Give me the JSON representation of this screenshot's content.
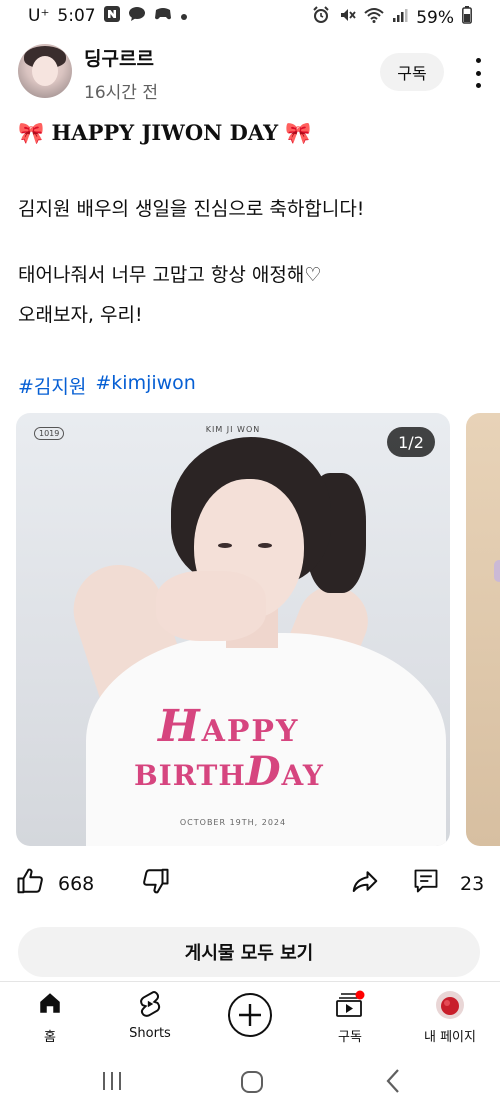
{
  "status_bar": {
    "carrier": "U⁺",
    "time": "5:07",
    "battery": "59%"
  },
  "post": {
    "channel_name": "딩구르르",
    "time_ago": "16시간 전",
    "subscribe_label": "구독",
    "title_emoji_left": "🎀",
    "title_text": "HAPPY JIWON DAY",
    "title_emoji_right": "🎀",
    "body_line_1": "김지원 배우의 생일을 진심으로 축하합니다!",
    "body_line_2": "태어나줘서 너무 고맙고 항상 애정해♡",
    "body_line_3": "오래보자, 우리!",
    "hashtags": [
      "#김지원",
      "#kimjiwon"
    ]
  },
  "image": {
    "counter": "1/2",
    "logo_badge": "1019",
    "top_caption": "KIM JI WON",
    "birthday_line_1_initial": "H",
    "birthday_line_1_rest": "APPY",
    "birthday_line_2_start": "BIRTH",
    "birthday_line_2_initial": "D",
    "birthday_line_2_rest": "AY",
    "date_caption": "OCTOBER 19TH, 2024"
  },
  "actions": {
    "like_count": "668",
    "comment_count": "23"
  },
  "see_all_label": "게시물 모두 보기",
  "bottom_nav": {
    "items": [
      {
        "label": "홈",
        "icon": "home-icon"
      },
      {
        "label": "Shorts",
        "icon": "shorts-icon"
      },
      {
        "label": "",
        "icon": "create-icon"
      },
      {
        "label": "구독",
        "icon": "subscriptions-icon"
      },
      {
        "label": "내 페이지",
        "icon": "profile-avatar"
      }
    ]
  },
  "colors": {
    "hashtag": "#065fd4",
    "birthday_text": "#d6457f",
    "notification_dot": "#ff0000"
  }
}
